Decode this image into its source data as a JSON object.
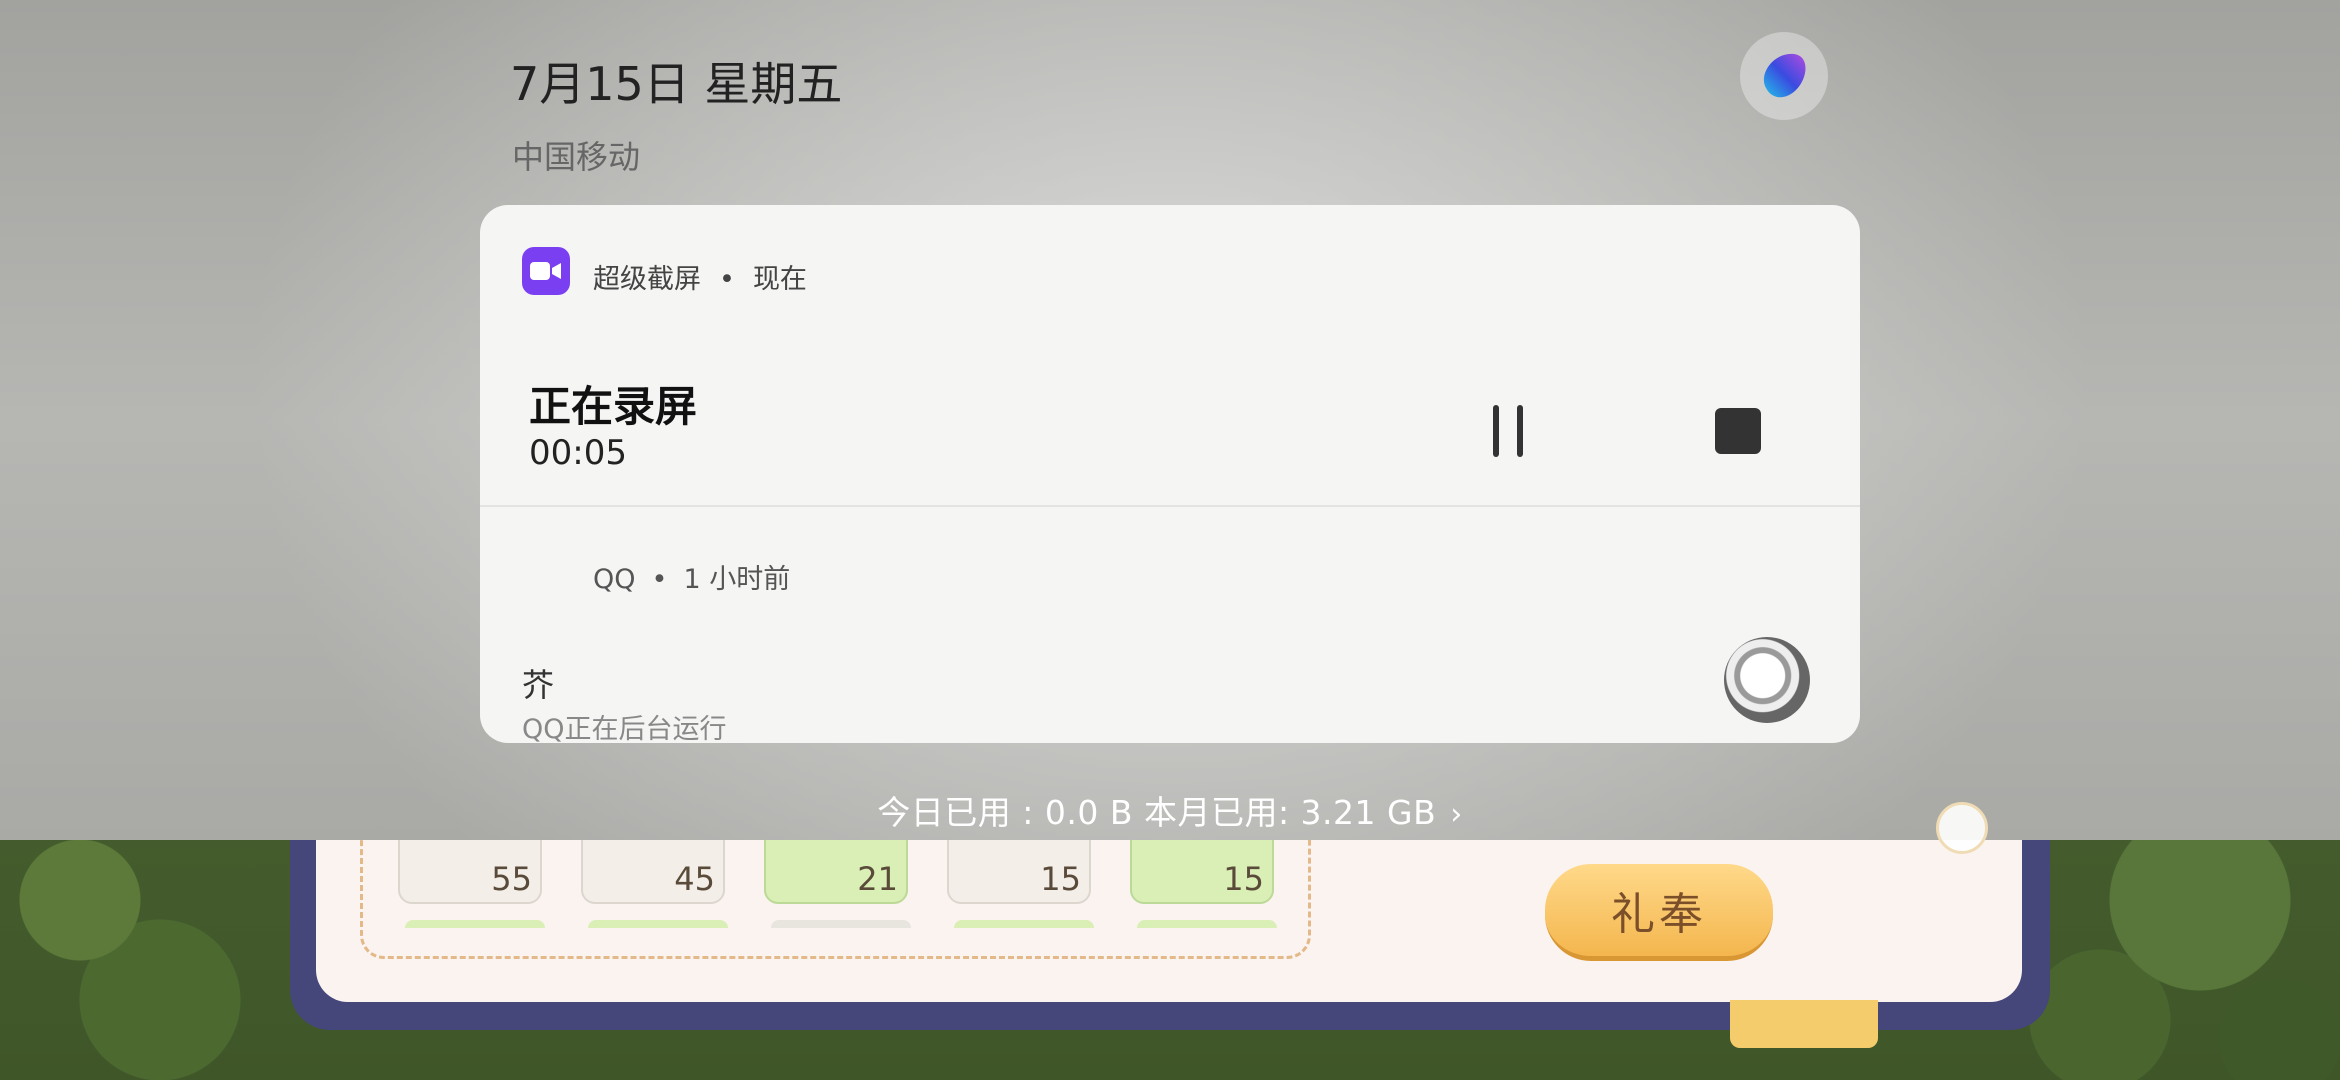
{
  "status_shade": {
    "date": "7月15日 星期五",
    "carrier": "中国移动"
  },
  "screen_recording": {
    "app_name": "超级截屏",
    "separator": "•",
    "time": "现在",
    "title": "正在录屏",
    "timer": "00:05",
    "app_color": "#7b3ff2"
  },
  "qq_notification": {
    "app_name": "QQ",
    "separator": "•",
    "time": "1 小时前",
    "title": "芥",
    "body": "QQ正在后台运行"
  },
  "data_usage": {
    "text": "今日已用 : 0.0 B 本月已用: 3.21 GB",
    "chevron": "›"
  },
  "game": {
    "slots": [
      {
        "count": "55",
        "color": "#f3efe8"
      },
      {
        "count": "45",
        "color": "#f3efe8"
      },
      {
        "count": "21",
        "color": "#d9efb5"
      },
      {
        "count": "15",
        "color": "#f3efe8"
      },
      {
        "count": "15",
        "color": "#d9efb5"
      }
    ],
    "offer_button": "礼奉"
  }
}
